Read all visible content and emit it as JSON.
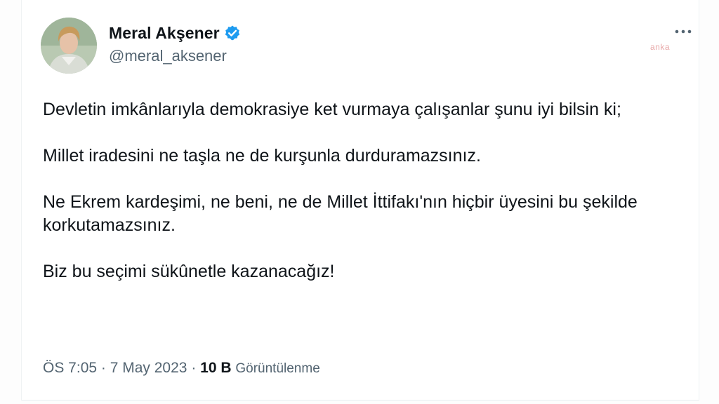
{
  "user": {
    "display_name": "Meral Akşener",
    "handle": "@meral_aksener",
    "verified_color": "#1d9bf0",
    "verified_icon": "verified-badge-icon",
    "avatar_icon": "profile-photo"
  },
  "watermark": "anka",
  "menu": {
    "icon": "more-options-icon"
  },
  "tweet": {
    "paragraphs": [
      "Devletin imkânlarıyla demokrasiye ket vurmaya çalışanlar şunu iyi bilsin ki;",
      "Millet iradesini ne taşla ne de kurşunla durduramazsınız.",
      "Ne Ekrem kardeşimi, ne beni, ne de Millet İttifakı'nın hiçbir üyesini bu şekilde korkutamazsınız.",
      "Biz bu seçimi sükûnetle kazanacağız!"
    ]
  },
  "meta": {
    "time": "ÖS 7:05",
    "separator": " · ",
    "date": "7 May 2023",
    "views_count": "10 B",
    "views_label": "Görüntülenme"
  }
}
